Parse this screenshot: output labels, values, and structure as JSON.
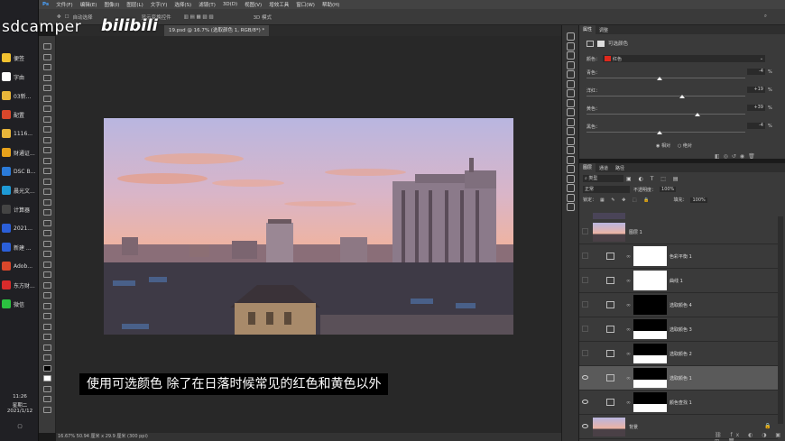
{
  "watermark": {
    "channel": "sdcamper",
    "platform": "bilibili"
  },
  "menubar": [
    "文件(F)",
    "编辑(E)",
    "图像(I)",
    "图层(L)",
    "文字(Y)",
    "选择(S)",
    "滤镜(T)",
    "3D(D)",
    "视图(V)",
    "增效工具",
    "窗口(W)",
    "帮助(H)"
  ],
  "options": {
    "auto_select": "自动选择",
    "transform": "显示变换控件",
    "mode3d": "3D 模式"
  },
  "document_tab": "19.psd @ 16.7% (选取颜色 1, RGB/8*) *",
  "taskbar": {
    "items": [
      {
        "label": "便签",
        "color": "#f2c230"
      },
      {
        "label": "字由",
        "color": "#ffffff"
      },
      {
        "label": "03新...",
        "color": "#e8b53a"
      },
      {
        "label": "配置",
        "color": "#d9472b"
      },
      {
        "label": "1116...",
        "color": "#e8b53a"
      },
      {
        "label": "财通证...",
        "color": "#e8a21b"
      },
      {
        "label": "DSC B...",
        "color": "#2b7bd9"
      },
      {
        "label": "晨光文...",
        "color": "#1e9ad6"
      },
      {
        "label": "计算器",
        "color": "#444444"
      },
      {
        "label": "2021...",
        "color": "#2b5fd9"
      },
      {
        "label": "新建 ...",
        "color": "#2b5fd9"
      },
      {
        "label": "Adob...",
        "color": "#d9472b"
      },
      {
        "label": "东方财...",
        "color": "#d92b2b"
      },
      {
        "label": "微信",
        "color": "#2bc240"
      }
    ],
    "time": "11:26",
    "weekday": "星期二",
    "date": "2021/1/12"
  },
  "properties": {
    "tabs": [
      "属性",
      "调整"
    ],
    "title": "可选颜色",
    "preset_label": "颜色：",
    "color_value": "红色",
    "sliders": [
      {
        "label": "青色：",
        "value": "-4",
        "pct": "%",
        "pos": 0.46
      },
      {
        "label": "洋红：",
        "value": "+19",
        "pct": "%",
        "pos": 0.6
      },
      {
        "label": "黄色：",
        "value": "+39",
        "pct": "%",
        "pos": 0.7
      },
      {
        "label": "黑色：",
        "value": "-4",
        "pct": "%",
        "pos": 0.46
      }
    ],
    "method_relative": "相对",
    "method_absolute": "绝对"
  },
  "layers_panel": {
    "tabs": [
      "图层",
      "通道",
      "路径"
    ],
    "filter": "类型",
    "blend_mode": "正常",
    "opacity_label": "不透明度：",
    "opacity": "100%",
    "lock_label": "锁定：",
    "fill_label": "填充：",
    "fill": "100%",
    "layers": [
      {
        "name": "图层 1",
        "type": "photo",
        "visible": false
      },
      {
        "name": "色彩平衡 1",
        "type": "adj",
        "visible": false,
        "mask": "white"
      },
      {
        "name": "曲线 1",
        "type": "adj",
        "visible": false,
        "mask": "white"
      },
      {
        "name": "选取颜色 4",
        "type": "adj",
        "visible": false,
        "mask": "black"
      },
      {
        "name": "选取颜色 3",
        "type": "adj",
        "visible": false,
        "mask": "sky"
      },
      {
        "name": "选取颜色 2",
        "type": "adj",
        "visible": false,
        "mask": "sky"
      },
      {
        "name": "选取颜色 1",
        "type": "adj",
        "visible": true,
        "mask": "sky",
        "selected": true
      },
      {
        "name": "颜色查找 1",
        "type": "adj",
        "visible": true,
        "mask": "sky"
      },
      {
        "name": "背景",
        "type": "photo",
        "visible": true,
        "locked": true
      }
    ]
  },
  "status": "16.67%   50.94 厘米 x 29.9 厘米 (300 ppi)",
  "subtitle": "使用可选颜色 除了在日落时候常见的红色和黄色以外"
}
